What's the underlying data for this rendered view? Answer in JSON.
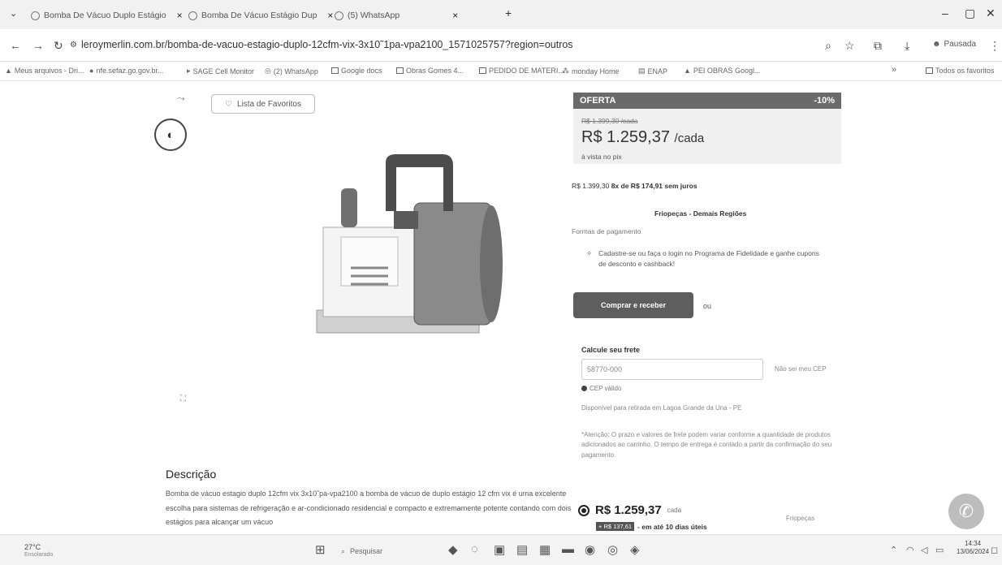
{
  "tabs": [
    {
      "label": "Bomba De Vácuo Duplo Estágio",
      "close": "×"
    },
    {
      "label": "Bomba De Vácuo Estágio Dup",
      "close": "×"
    },
    {
      "label": "(5) WhatsApp",
      "close": "×"
    }
  ],
  "new_tab": "+",
  "url": "leroymerlin.com.br/bomba-de-vacuo-estagio-duplo-12cfm-vix-3x10˜1pa-vpa2100_1571025757?region=outros",
  "profile_label": "Pausada",
  "bookmarks": [
    "Meus arquivos - Dri...",
    "nfe.sefaz.go.gov.br...",
    "SAGE Cell Monitor",
    "(2) WhatsApp",
    "Google docs",
    "Obras Gomes 4...",
    "PEDIDO DE MATERI...",
    "monday Home",
    "ENAP",
    "PEI OBRAS Googl..."
  ],
  "bookmarks_more": "»",
  "all_favorites": "Todos os favoritos",
  "fav_button": "Lista de Favoritos",
  "description_title": "Descrição",
  "description_text": "Bomba de vácuo estagio duplo 12cfm vix 3x10˜pa-vpa2100 a bomba de vácuo de duplo estágio 12 cfm vix é uma excelente escolha para sistemas de refrigeração e ar-condicionado residencial e compacto e extremamente potente contando com dois estágios para alcançar um vácuo",
  "offer": {
    "label": "OFERTA",
    "discount": "-10%"
  },
  "old_price": "R$ 1.399,30 /cada",
  "price": "R$ 1.259,37",
  "price_unit": "/cada",
  "avista": "à vista no pix",
  "installments_prefix": "R$ 1.399,30",
  "installments_text": "8x de R$ 174,91 sem juros",
  "seller": "Friopeças - Demais Regiões",
  "formas": "Formas de pagamento",
  "loyalty_text": "Cadastre-se ou faça o login no Programa de Fidelidade e ganhe cupons de desconto e cashback!",
  "buy_button": "Comprar e receber",
  "ou": "ou",
  "frete_title": "Calcule seu frete",
  "cep_value": "58770-000",
  "nao_sei": "Não sei meu CEP",
  "cep_valid": "CEP válido",
  "retira": "Disponível para retirada em Lagoa Grande da Una - PE",
  "atencao": "*Atenção: O prazo e valores de frete podem variar conforme a quantidade de produtos adicionados ao carrinho. O tempo de entrega é contado a partir da confirmação do seu pagamento.",
  "radio_price": "R$ 1.259,37",
  "radio_unit": "cada",
  "frete_tag": "+ R$ 137,61",
  "frete_days": "- em até 10 dias úteis",
  "seller2": "Friopeças",
  "weather": {
    "temp": "27°C",
    "sub": "Ensolarado"
  },
  "taskbar_search": "Pesquisar",
  "clock": {
    "time": "14:34",
    "date": "13/06/2024"
  }
}
